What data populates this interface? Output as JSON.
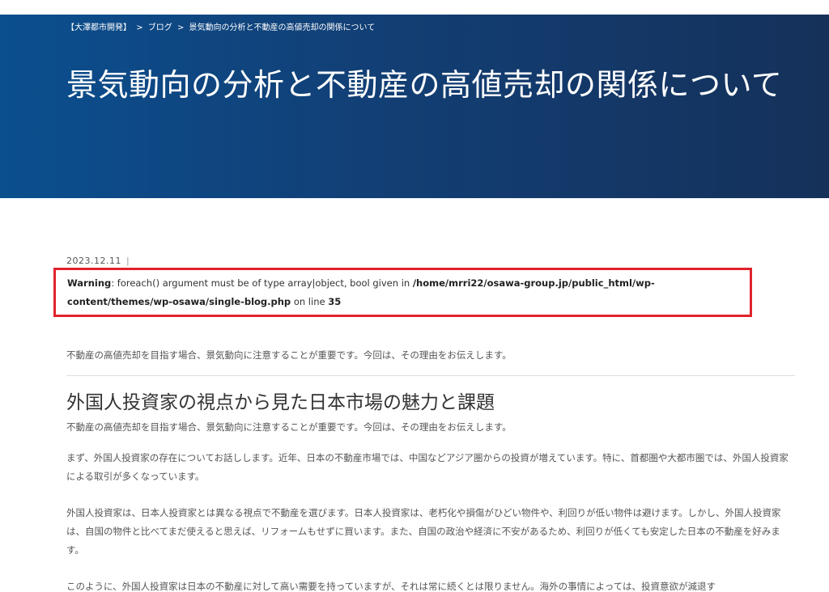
{
  "breadcrumb": {
    "home": "【大澤都市開発】",
    "sep1": ">",
    "blog": "ブログ",
    "sep2": ">",
    "current": "景気動向の分析と不動産の高値売却の関係について"
  },
  "hero": {
    "title": "景気動向の分析と不動産の高値売却の関係について"
  },
  "meta": {
    "date": "2023.12.11",
    "separator": "|"
  },
  "warning": {
    "label": "Warning",
    "message": ": foreach() argument must be of type array|object, bool given in ",
    "path": "/home/mrri22/osawa-group.jp/public_html/wp-content/themes/wp-osawa/single-blog.php",
    "line_text": " on line ",
    "line_number": "35"
  },
  "article": {
    "intro": "不動産の高値売却を目指す場合、景気動向に注意することが重要です。今回は、その理由をお伝えします。",
    "section_title": "外国人投資家の視点から見た日本市場の魅力と課題",
    "section_sub": "不動産の高値売却を目指す場合、景気動向に注意することが重要です。今回は、その理由をお伝えします。",
    "p1": "まず、外国人投資家の存在についてお話しします。近年、日本の不動産市場では、中国などアジア圏からの投資が増えています。特に、首都圏や大都市圏では、外国人投資家による取引が多くなっています。",
    "p2": "外国人投資家は、日本人投資家とは異なる視点で不動産を選びます。日本人投資家は、老朽化や損傷がひどい物件や、利回りが低い物件は避けます。しかし、外国人投資家は、自国の物件と比べてまだ使えると思えば、リフォームもせずに買います。また、自国の政治や経済に不安があるため、利回りが低くても安定した日本の不動産を好みます。",
    "p3": "このように、外国人投資家は日本の不動産に対して高い需要を持っていますが、それは常に続くとは限りません。海外の事情によっては、投資意欲が減退す"
  }
}
